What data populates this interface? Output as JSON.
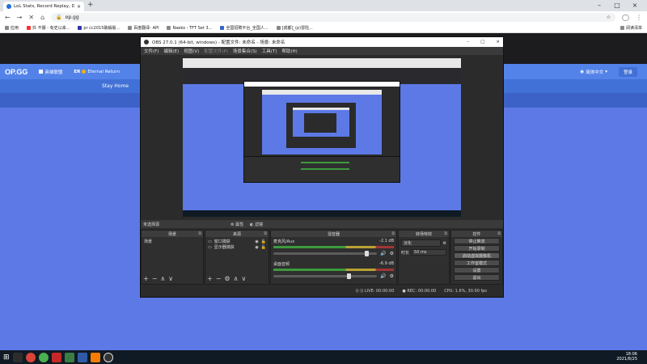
{
  "browser": {
    "tab_title": "LoL Stats, Record Replay, Data",
    "new_tab": "+",
    "url": "op.gg",
    "bookmarks": [
      "应用",
      "抖 不服 - 有史以来...",
      "pr cc2015破解版...",
      "百度翻译- API",
      "Naeko - TFT Set 3...",
      "全国招聘平台_全国人...",
      "[成都]_(p)冒险..."
    ],
    "reading_list": "阅读清单"
  },
  "site": {
    "logo": "OP.GG",
    "nav_home": "英雄联盟",
    "nav_eternal": "Eternal Return",
    "nav_more": "稿米",
    "lang": "简体中文",
    "login": "登录",
    "stay_home": "Stay Home"
  },
  "obs": {
    "title": "OBS 27.0.1 (64-bit, windows) - 配置文件: 未命名 - 场景: 未命名",
    "menu": [
      "文件(F)",
      "编辑(E)",
      "视图(V)",
      "配置文件(P)",
      "场景集合(S)",
      "工具(T)",
      "帮助(H)"
    ],
    "no_source": "未选择源",
    "properties": "属性",
    "filters": "滤镜",
    "scenes_title": "场景",
    "scenes": [
      "场景"
    ],
    "sources_title": "来源",
    "sources": [
      "窗口捕获",
      "显示器捕获"
    ],
    "mixer_title": "混音器",
    "mixer": [
      {
        "name": "麦克风/Aux",
        "level": "-2.1 dB",
        "volume": 0.92
      },
      {
        "name": "桌面音频",
        "level": "-6.9 dB",
        "volume": 0.75
      }
    ],
    "transitions_title": "转场特效",
    "transition_type": "淡化",
    "duration_label": "时长",
    "duration_value": "50 ms",
    "controls_title": "控件",
    "controls": [
      "停止推流",
      "开始录制",
      "启动虚拟摄像机",
      "工作室模式",
      "设置",
      "退出"
    ],
    "status": {
      "live": "LIVE: 00:00:00",
      "rec": "REC: 00:00:00",
      "cpu": "CPU: 1.6%, 30.00 fps"
    }
  },
  "taskbar": {
    "time": "18:06",
    "date": "2021/8/25"
  },
  "colors": {
    "page_blue": "#5c79e6",
    "nav_blue": "#5383e8",
    "obs_dark": "#2b2b2b"
  }
}
